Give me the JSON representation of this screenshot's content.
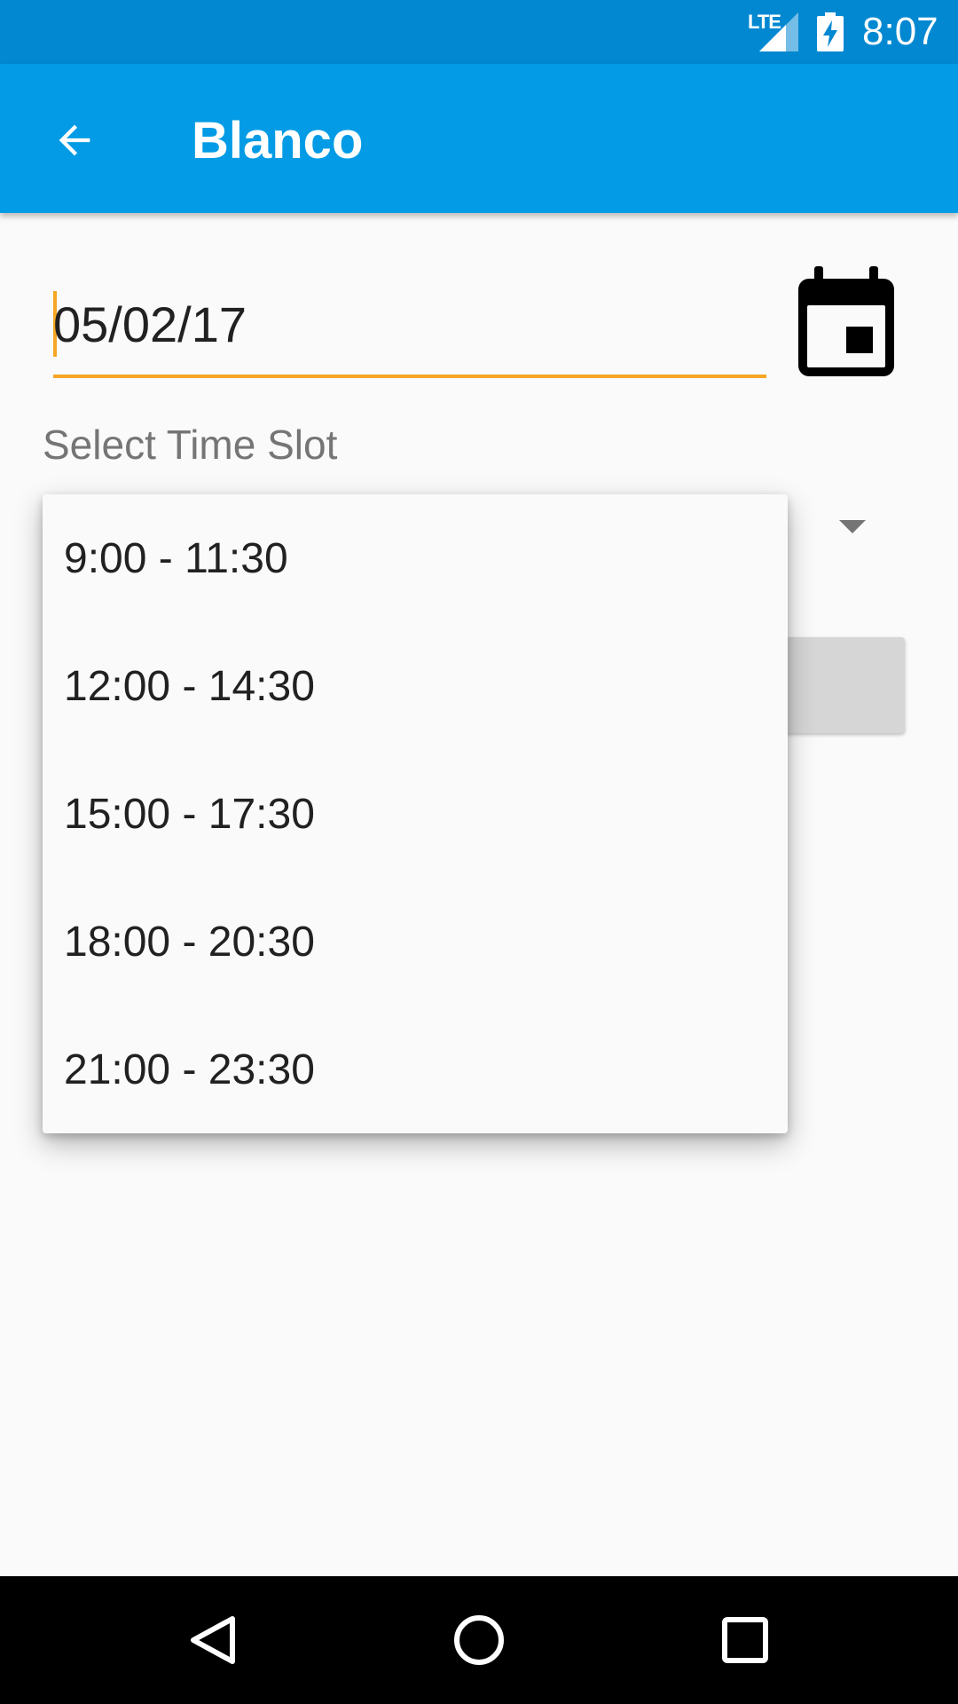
{
  "status_bar": {
    "network": "LTE",
    "time": "8:07",
    "signal_icon": "signal-icon",
    "battery_icon": "battery-charging-icon"
  },
  "app_bar": {
    "title": "Blanco",
    "back_icon": "arrow-back-icon"
  },
  "date_field": {
    "value": "05/02/17",
    "calendar_icon": "calendar-icon"
  },
  "time_slot": {
    "label": "Select Time Slot",
    "options": [
      "9:00 - 11:30",
      "12:00 - 14:30",
      "15:00 - 17:30",
      "18:00 - 20:30",
      "21:00 - 23:30"
    ]
  },
  "nav_bar": {
    "back_icon": "nav-back-icon",
    "home_icon": "nav-home-icon",
    "recents_icon": "nav-recents-icon"
  },
  "colors": {
    "status_bar": "#0288d1",
    "app_bar": "#039be5",
    "accent": "#f5a623"
  }
}
